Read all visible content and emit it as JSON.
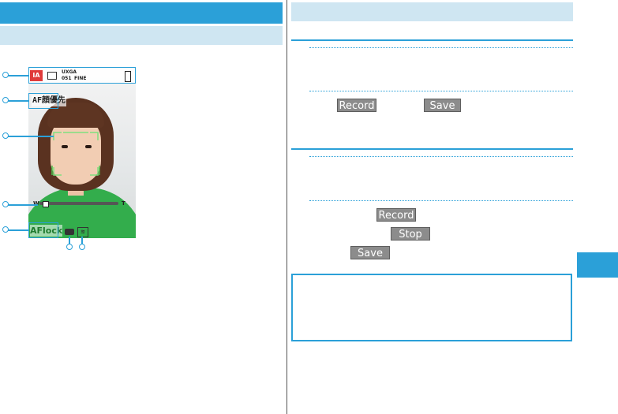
{
  "photo_screen": {
    "status_badge": "IA",
    "status_size_text": "UXGA",
    "status_count": "051",
    "status_quality": "FINE",
    "af_mode_label": "AF顔優先",
    "af_lock_label": "AFlock",
    "zoom_min_label": "W",
    "zoom_max_label": "T"
  },
  "softkeys": {
    "record": "Record",
    "save": "Save",
    "stop": "Stop"
  },
  "colors": {
    "accent": "#2ba0d8",
    "light_bar": "#cfe6f2",
    "softkey_bg": "#8c8c8c"
  },
  "icons": [
    "frame-icon",
    "camera-icon",
    "battery-icon",
    "stabilizer-icon"
  ]
}
